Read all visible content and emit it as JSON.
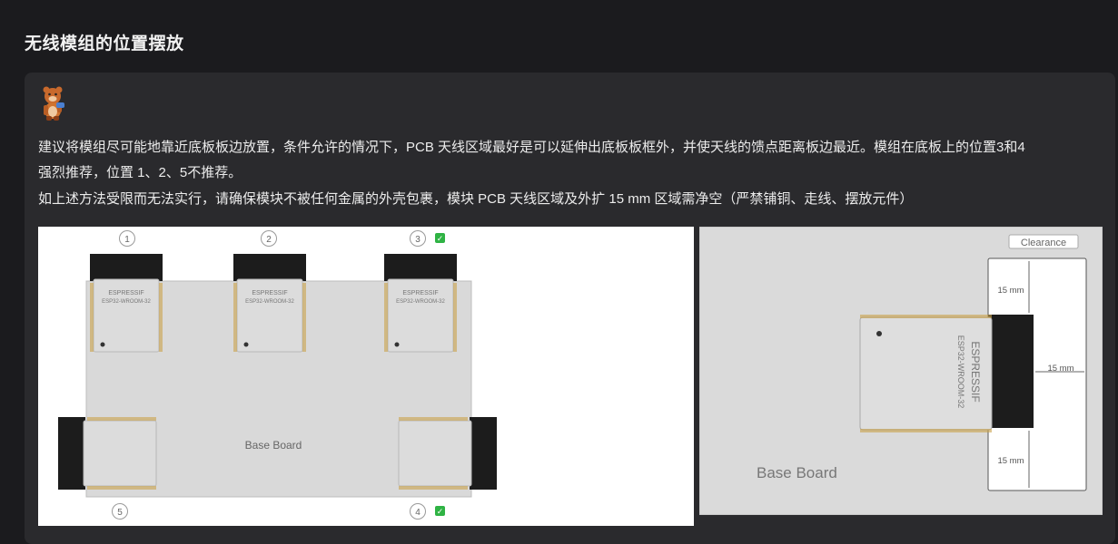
{
  "section": {
    "title": "无线模组的位置摆放"
  },
  "content": {
    "para1_line1": "建议将模组尽可能地靠近底板板边放置，条件允许的情况下，PCB 天线区域最好是可以延伸出底板板框外，并使天线的馈点距离板边最近。模组在底板上的位置3和4",
    "para1_line2": "强烈推荐，位置 1、2、5不推荐。",
    "para2": "如上述方法受限而无法实行，请确保模块不被任何金属的外壳包裹，模块 PCB 天线区域及外扩 15 mm 区域需净空（严禁铺铜、走线、摆放元件）"
  },
  "figure_left": {
    "base_label": "Base Board",
    "positions": [
      "1",
      "2",
      "3",
      "4",
      "5"
    ],
    "module_brand": "ESPRESSIF",
    "module_model": "ESP32-WROOM-32",
    "check_glyph": "✓"
  },
  "figure_right": {
    "clearance_label": "Clearance",
    "dim_top": "15 mm",
    "dim_right": "15 mm",
    "dim_bottom": "15 mm",
    "base_label": "Base Board",
    "module_brand": "ESPRESSIF",
    "module_model": "ESP32-WROOM-32"
  },
  "colors": {
    "page_bg": "#1b1b1e",
    "card_bg": "#2a2a2d",
    "board_gray": "#d9d9d9",
    "module_silver": "#dedede",
    "antenna_black": "#1a1a1a",
    "check_green": "#2fb344"
  }
}
